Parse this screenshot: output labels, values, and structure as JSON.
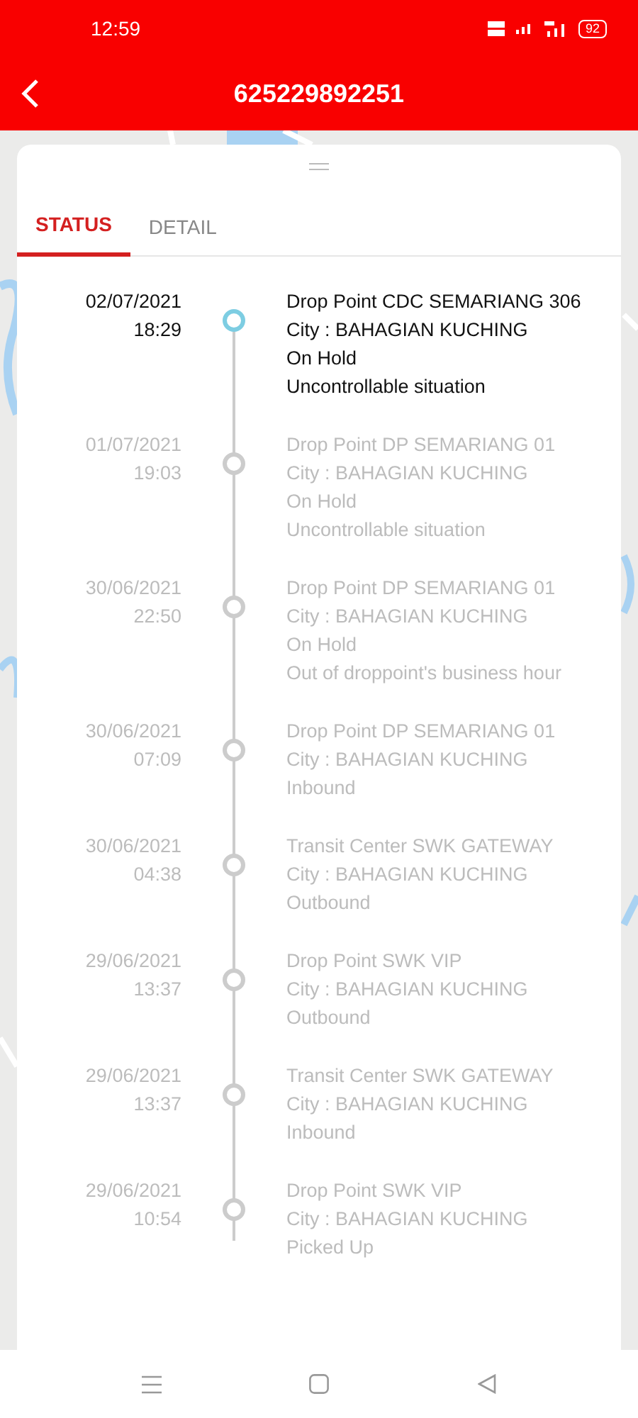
{
  "status_bar": {
    "time": "12:59",
    "battery": "92"
  },
  "header": {
    "title": "625229892251"
  },
  "tabs": [
    {
      "label": "STATUS",
      "selected": true
    },
    {
      "label": "DETAIL",
      "selected": false
    }
  ],
  "events": [
    {
      "date": "02/07/2021",
      "time": "18:29",
      "lines": [
        "Drop Point CDC SEMARIANG 306",
        "City : BAHAGIAN KUCHING",
        "On Hold",
        "Uncontrollable situation"
      ],
      "current": true
    },
    {
      "date": "01/07/2021",
      "time": "19:03",
      "lines": [
        "Drop Point DP SEMARIANG 01",
        "City : BAHAGIAN KUCHING",
        "On Hold",
        "Uncontrollable situation"
      ],
      "current": false
    },
    {
      "date": "30/06/2021",
      "time": "22:50",
      "lines": [
        "Drop Point DP SEMARIANG 01",
        "City : BAHAGIAN KUCHING",
        "On Hold",
        "Out of droppoint's business hour"
      ],
      "current": false
    },
    {
      "date": "30/06/2021",
      "time": "07:09",
      "lines": [
        "Drop Point DP SEMARIANG 01",
        "City : BAHAGIAN KUCHING",
        "Inbound"
      ],
      "current": false
    },
    {
      "date": "30/06/2021",
      "time": "04:38",
      "lines": [
        "Transit Center SWK GATEWAY",
        "City : BAHAGIAN KUCHING",
        "Outbound"
      ],
      "current": false
    },
    {
      "date": "29/06/2021",
      "time": "13:37",
      "lines": [
        "Drop Point SWK VIP",
        "City : BAHAGIAN KUCHING",
        "Outbound"
      ],
      "current": false
    },
    {
      "date": "29/06/2021",
      "time": "13:37",
      "lines": [
        "Transit Center SWK GATEWAY",
        "City : BAHAGIAN KUCHING",
        "Inbound"
      ],
      "current": false
    },
    {
      "date": "29/06/2021",
      "time": "10:54",
      "lines": [
        "Drop Point SWK VIP",
        "City : BAHAGIAN KUCHING",
        "Picked Up"
      ],
      "current": false
    }
  ]
}
